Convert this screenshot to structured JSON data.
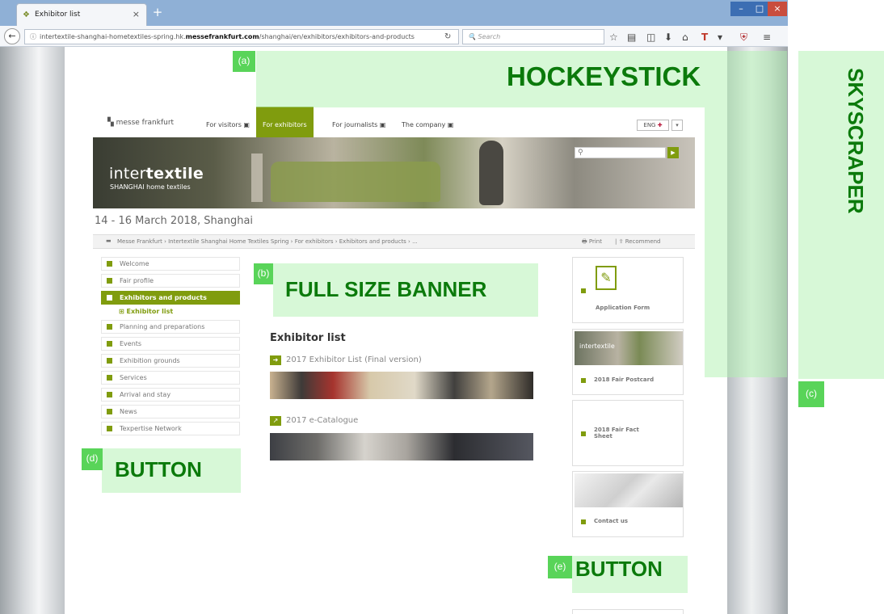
{
  "browser": {
    "tab_title": "Exhibitor list",
    "url_prefix": "intertextile-shanghai-hometextiles-spring.hk.",
    "url_domain": "messefrankfurt.com",
    "url_path": "/shanghai/en/exhibitors/exhibitors-and-products",
    "search_placeholder": "Search"
  },
  "site": {
    "logo": "messe frankfurt",
    "nav": [
      "For visitors",
      "For exhibitors",
      "For journalists",
      "The company"
    ],
    "language": "ENG",
    "hero_logo_light": "inter",
    "hero_logo_bold": "textile",
    "hero_subtitle": "SHANGHAI home textiles",
    "date_line": "14 - 16 March 2018, Shanghai",
    "breadcrumb": "Messe Frankfurt › Intertextile Shanghai Home Textiles Spring › For exhibitors › Exhibitors and products › ...",
    "print": "Print",
    "recommend": "Recommend"
  },
  "menu": {
    "items": [
      "Welcome",
      "Fair profile",
      "Exhibitors and products",
      "Planning and preparations",
      "Events",
      "Exhibition grounds",
      "Services",
      "Arrival and stay",
      "News",
      "Texpertise Network"
    ],
    "active_index": 2,
    "submenu": "Exhibitor list"
  },
  "content": {
    "title": "Exhibitor list",
    "links": [
      "2017 Exhibitor List (Final version)",
      "2017 e-Catalogue"
    ]
  },
  "sidebar": {
    "cards": [
      "Application Form",
      "2018 Fair Postcard",
      "2018 Fair Fact Sheet",
      "Contact us"
    ],
    "postcard_image_text": "intertextile"
  },
  "annotations": {
    "a": {
      "tag": "(a)",
      "label": "HOCKEYSTICK"
    },
    "b": {
      "tag": "(b)",
      "label": "FULL SIZE BANNER"
    },
    "c": {
      "tag": "(c)",
      "label": "SKYSCRAPER"
    },
    "d": {
      "tag": "(d)",
      "label": "BUTTON"
    },
    "e": {
      "tag": "(e)",
      "label": "BUTTON"
    }
  },
  "colors": {
    "brand_green": "#809c0e",
    "annotation_green": "#0b7a0b",
    "annotation_fill": "#aff2af"
  }
}
